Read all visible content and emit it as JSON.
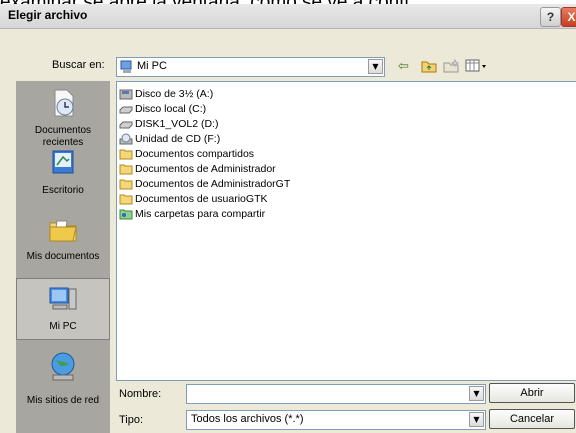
{
  "background_text": "examinar se abre la ventana, como se ve a conti",
  "window": {
    "title": "Elegir archivo",
    "help_label": "?",
    "close_label": "X"
  },
  "lookin": {
    "label": "Buscar en:",
    "value": "Mi PC"
  },
  "places": [
    {
      "label": "Documentos recientes",
      "icon": "recent-documents-icon"
    },
    {
      "label": "Escritorio",
      "icon": "desktop-icon"
    },
    {
      "label": "Mis documentos",
      "icon": "my-documents-icon"
    },
    {
      "label": "Mi PC",
      "icon": "my-computer-icon",
      "selected": true
    },
    {
      "label": "Mis sitios de red",
      "icon": "network-places-icon"
    }
  ],
  "files": [
    {
      "name": "Disco de 3½ (A:)",
      "icon": "floppy-drive-icon"
    },
    {
      "name": "Disco local (C:)",
      "icon": "hard-drive-icon"
    },
    {
      "name": "DISK1_VOL2 (D:)",
      "icon": "hard-drive-icon"
    },
    {
      "name": "Unidad de CD (F:)",
      "icon": "cd-drive-icon"
    },
    {
      "name": "Documentos compartidos",
      "icon": "folder-icon"
    },
    {
      "name": "Documentos de Administrador",
      "icon": "folder-icon"
    },
    {
      "name": "Documentos de AdministradorGT",
      "icon": "folder-icon"
    },
    {
      "name": "Documentos de usuarioGTK",
      "icon": "folder-icon"
    },
    {
      "name": "Mis carpetas para compartir",
      "icon": "shared-folders-icon"
    }
  ],
  "filename": {
    "label": "Nombre:",
    "value": ""
  },
  "filetype": {
    "label": "Tipo:",
    "value": "Todos los archivos (*.*)"
  },
  "buttons": {
    "open": "Abrir",
    "cancel": "Cancelar"
  },
  "colors": {
    "dialog_bg": "#ece9d8",
    "places_bar": "#a8a6a0",
    "field_border": "#7f9db9"
  }
}
